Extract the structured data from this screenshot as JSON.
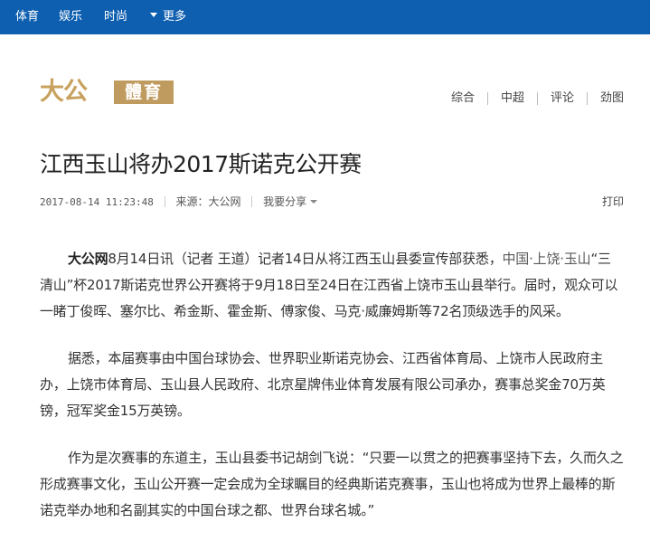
{
  "topnav": {
    "items": [
      "体育",
      "娱乐",
      "时尚"
    ],
    "more_label": "更多"
  },
  "logo": {
    "brand_text": "大公",
    "section_text": "體育"
  },
  "category_nav": [
    "综合",
    "中超",
    "评论",
    "劲图"
  ],
  "article": {
    "title": "江西玉山将办2017斯诺克公开赛",
    "meta": {
      "datetime": "2017-08-14 11:23:48",
      "source": "来源：大公网",
      "share_label": "我要分享"
    },
    "print_label": "打印",
    "paragraphs": [
      {
        "lead": "大公网",
        "text": "8月14日讯（记者 王道）记者14日从将江西玉山县委宣传部获悉，",
        "link": "中国·上饶·玉山",
        "rest": "“三清山”杯2017斯诺克世界公开赛将于9月18日至24日在江西省上饶市玉山县举行。届时，观众可以一睹丁俊晖、塞尔比、希金斯、霍金斯、傅家俊、马克·威廉姆斯等72名顶级选手的风采。"
      },
      {
        "text": "据悉，本届赛事由中国台球协会、世界职业斯诺克协会、江西省体育局、上饶市人民政府主办，上饶市体育局、玉山县人民政府、北京星牌伟业体育发展有限公司承办，赛事总奖金70万英镑，冠军奖金15万英镑。"
      },
      {
        "text": "作为是次赛事的东道主，玉山县委书记胡剑飞说：“只要一以贯之的把赛事坚持下去，久而久之形成赛事文化，玉山公开赛一定会成为全球瞩目的经典斯诺克赛事，玉山也将成为世界上最棒的斯诺克举办地和名副其实的中国台球之都、世界台球名城。”"
      }
    ]
  },
  "colors": {
    "nav_background": "#0e5fb0",
    "logo_gold": "#c8a15e",
    "logo_box": "#c09b5f"
  }
}
